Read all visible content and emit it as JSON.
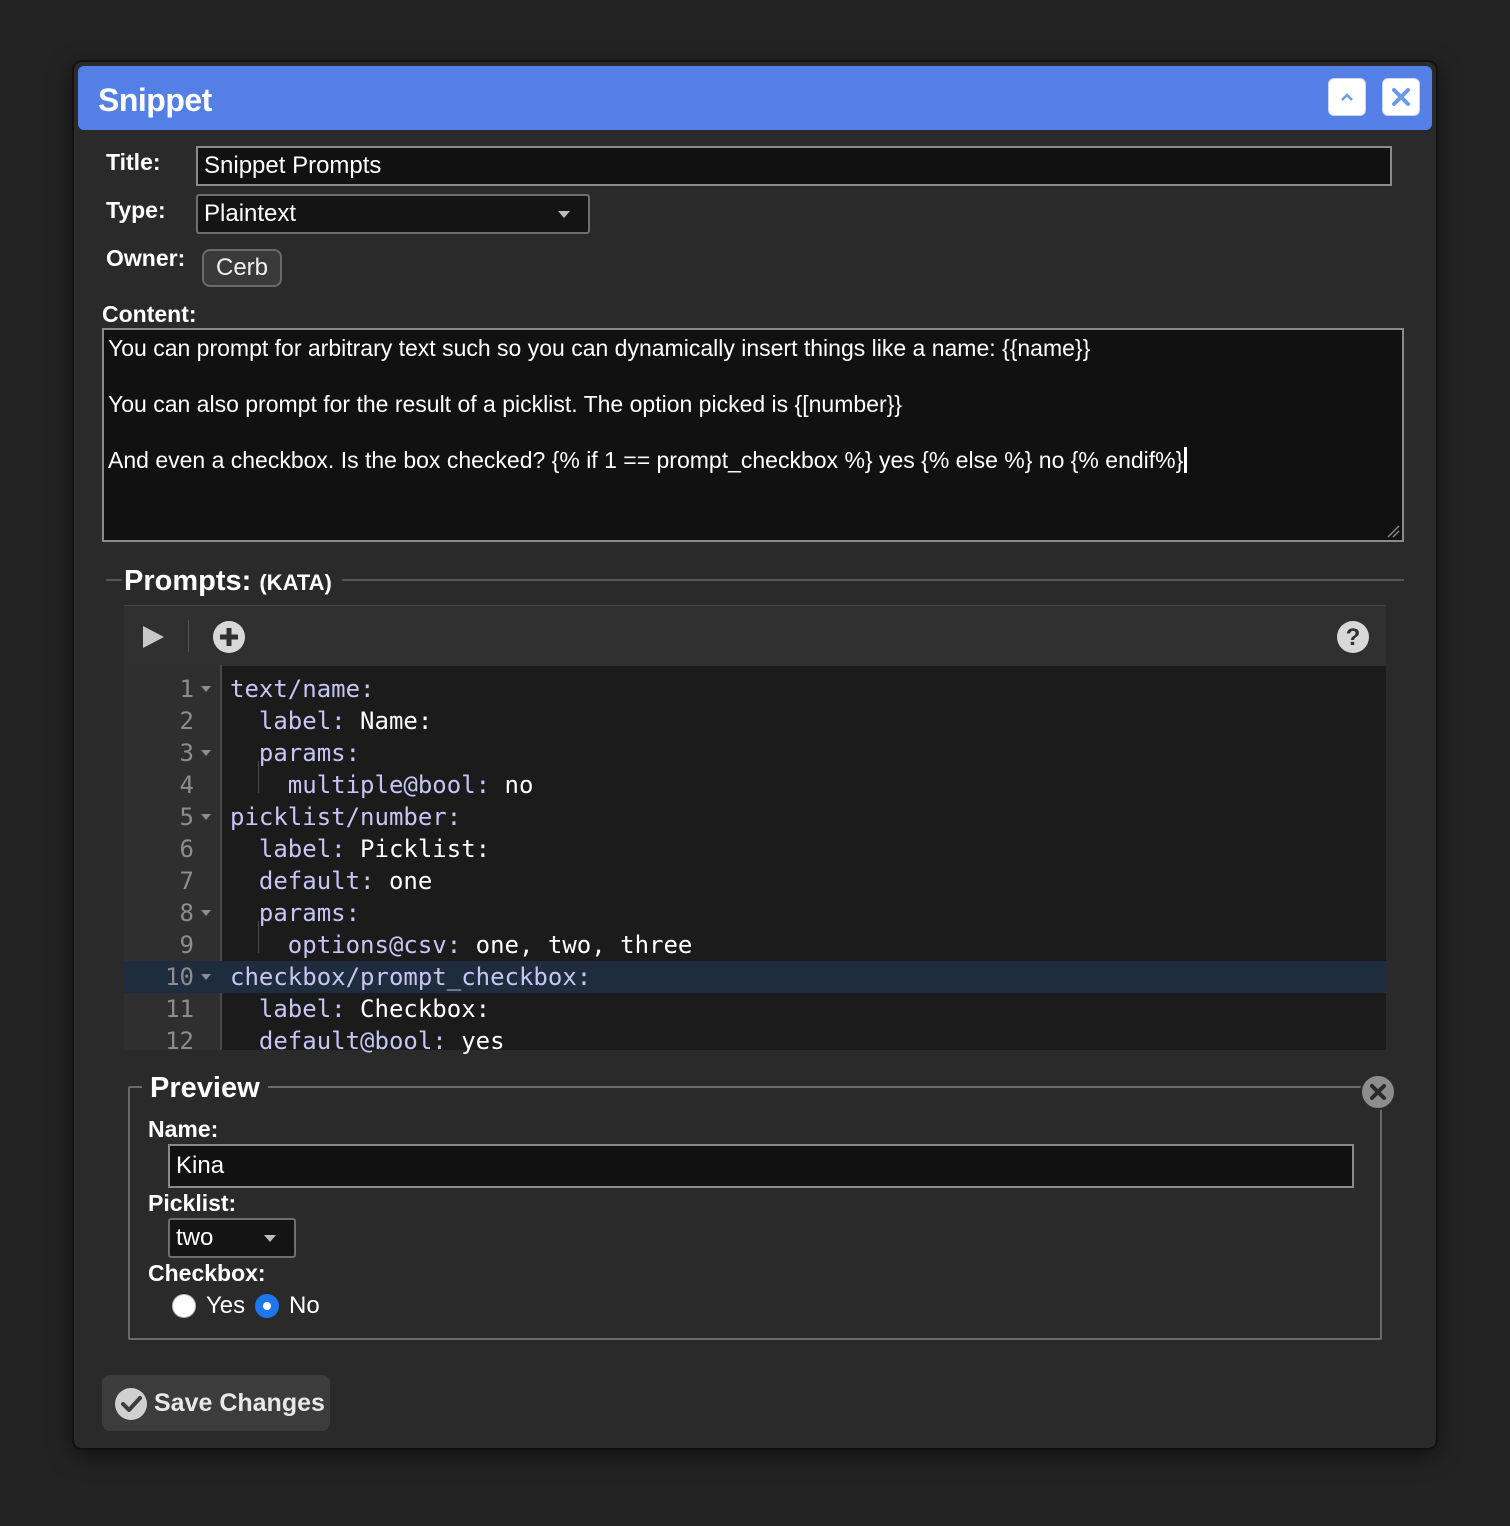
{
  "dialog": {
    "title": "Snippet",
    "collapse_icon": "chevron-up-icon",
    "close_icon": "close-icon"
  },
  "form": {
    "title_label": "Title:",
    "title_value": "Snippet Prompts",
    "type_label": "Type:",
    "type_value": "Plaintext",
    "owner_label": "Owner:",
    "owner_value": "Cerb",
    "content_label": "Content:",
    "content_lines": [
      "You can prompt for arbitrary text such so you can dynamically insert things like a name: {{name}}",
      "",
      "You can also prompt for the result of a picklist. The option picked is {[number}}",
      "",
      "And even a checkbox. Is the box checked? {% if 1 == prompt_checkbox %} yes {% else %} no {% endif%}"
    ]
  },
  "prompts": {
    "title": "Prompts:",
    "subtitle": "(KATA)",
    "toolbar": {
      "run_icon": "play-icon",
      "add_icon": "plus-circle-icon",
      "help_icon": "help-icon"
    },
    "lines": [
      {
        "n": "1",
        "fold": true,
        "indent": "",
        "key": "text/name:",
        "val": ""
      },
      {
        "n": "2",
        "fold": false,
        "indent": "  ",
        "key": "label:",
        "val": " Name:"
      },
      {
        "n": "3",
        "fold": true,
        "indent": "  ",
        "key": "params:",
        "val": ""
      },
      {
        "n": "4",
        "fold": false,
        "indent": "    ",
        "key": "multiple@bool:",
        "val": " no"
      },
      {
        "n": "5",
        "fold": true,
        "indent": "",
        "key": "picklist/number:",
        "val": ""
      },
      {
        "n": "6",
        "fold": false,
        "indent": "  ",
        "key": "label:",
        "val": " Picklist:"
      },
      {
        "n": "7",
        "fold": false,
        "indent": "  ",
        "key": "default:",
        "val": " one"
      },
      {
        "n": "8",
        "fold": true,
        "indent": "  ",
        "key": "params:",
        "val": ""
      },
      {
        "n": "9",
        "fold": false,
        "indent": "    ",
        "key": "options@csv:",
        "val": " one, two, three"
      },
      {
        "n": "10",
        "fold": true,
        "indent": "",
        "key": "checkbox/prompt_checkbox:",
        "val": "",
        "active": true
      },
      {
        "n": "11",
        "fold": false,
        "indent": "  ",
        "key": "label:",
        "val": " Checkbox:"
      },
      {
        "n": "12",
        "fold": false,
        "indent": "  ",
        "key": "default@bool:",
        "val": " yes"
      }
    ]
  },
  "preview": {
    "title": "Preview",
    "name_label": "Name:",
    "name_value": "Kina",
    "picklist_label": "Picklist:",
    "picklist_value": "two",
    "checkbox_label": "Checkbox:",
    "options": [
      {
        "label": "Yes",
        "selected": false
      },
      {
        "label": "No",
        "selected": true
      }
    ]
  },
  "actions": {
    "save_label": "Save Changes",
    "save_icon": "check-circle-icon"
  },
  "colors": {
    "titlebar": "#5480e6",
    "radio_selected": "#1d78ee",
    "background": "#2a2a2a"
  }
}
